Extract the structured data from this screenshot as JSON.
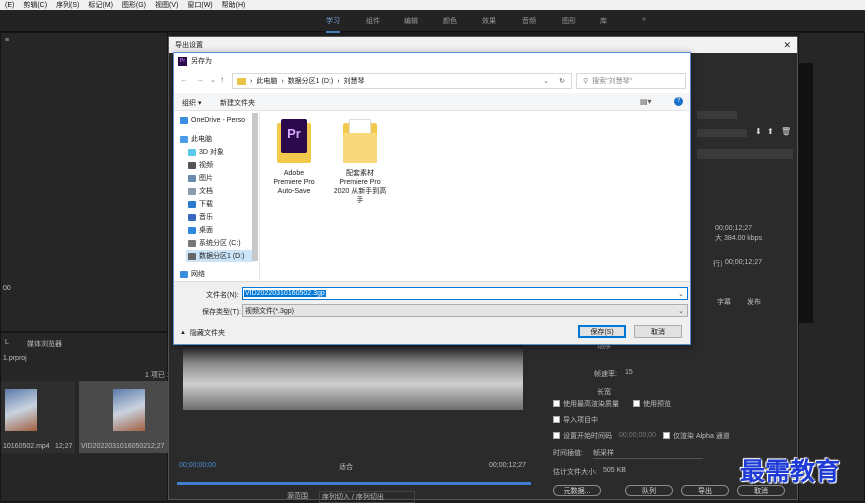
{
  "menubar": {
    "items": [
      "(E)",
      "剪辑(C)",
      "序列(S)",
      "标记(M)",
      "图形(G)",
      "视图(V)",
      "窗口(W)",
      "帮助(H)"
    ]
  },
  "workspace": {
    "tabs": [
      "学习",
      "组件",
      "编辑",
      "颜色",
      "效果",
      "音频",
      "图形",
      "库"
    ],
    "active": "学习",
    "more": "»"
  },
  "left_panel": {
    "tab1": "≡",
    "project_tab": "媒体浏览器",
    "project_file": "1.prproj",
    "items_count": "1 项已 1",
    "clips": [
      {
        "name": "10160502.mp4",
        "duration": "12;27"
      },
      {
        "name": "VID20220310160502",
        "duration": "12;27"
      }
    ]
  },
  "left_misc": {
    "text1": "00",
    "text2": "L"
  },
  "export_dialog": {
    "title": "导出设置",
    "close": "✕",
    "right_info": {
      "time": "00;00;12;27",
      "bitrate": "大 384.00 kbps",
      "time2": "00;00;12;27",
      "line1": "行）",
      "tabs": [
        "字幕",
        "发布"
      ]
    },
    "video_settings": {
      "frame_rate_label": "帧速率:",
      "frame_rate_value": "15",
      "field_label": "场序",
      "aspect_label": "长宽"
    },
    "options": {
      "max_depth": "使用最高渲染质量",
      "use_preview": "使用预览",
      "import_project": "导入项目中",
      "set_timecode": "设置开始时间码",
      "timecode_value": "00;00;00;00",
      "alpha_only": "仅渲染 Alpha 通道",
      "interp_label": "时间插值:",
      "interp_value": "帧采样",
      "filesize_label": "估计文件大小:",
      "filesize_value": "505 KB"
    },
    "buttons": {
      "metadata": "元数据...",
      "queue": "队列",
      "export": "导出",
      "cancel": "取消"
    },
    "timeline": {
      "start": "00;00;00;00",
      "end": "00;00;12;27",
      "fit": "适合",
      "range_label": "源范围",
      "range_value": "序列切入 / 序列切出"
    }
  },
  "saveas": {
    "title": "另存为",
    "breadcrumb": [
      "此电脑",
      "数据分区1 (D:)",
      "刘慧琴"
    ],
    "search_placeholder": "搜索\"刘慧琴\"",
    "toolbar": {
      "organize": "组织 ▾",
      "new_folder": "新建文件夹"
    },
    "nav": [
      {
        "label": "OneDrive - Perso",
        "icon": "cloud-icon"
      },
      {
        "label": "此电脑",
        "icon": "computer-icon"
      },
      {
        "label": "3D 对象",
        "icon": "cube-icon"
      },
      {
        "label": "视频",
        "icon": "video-icon"
      },
      {
        "label": "图片",
        "icon": "picture-icon"
      },
      {
        "label": "文档",
        "icon": "document-icon"
      },
      {
        "label": "下载",
        "icon": "download-icon"
      },
      {
        "label": "音乐",
        "icon": "music-icon"
      },
      {
        "label": "桌面",
        "icon": "desktop-icon"
      },
      {
        "label": "系统分区 (C:)",
        "icon": "drive-icon"
      },
      {
        "label": "数据分区1 (D:)",
        "icon": "drive-icon"
      },
      {
        "label": "网络",
        "icon": "network-icon"
      }
    ],
    "files": [
      {
        "lines": [
          "Adobe",
          "Premiere Pro",
          "Auto-Save"
        ]
      },
      {
        "lines": [
          "配套素材",
          "Premiere Pro",
          "2020 从新手到高",
          "手"
        ]
      }
    ],
    "filename_label": "文件名(N):",
    "filename_value": "VID20220310160502.3gp",
    "filetype_label": "保存类型(T):",
    "filetype_value": "视频文件(*.3gp)",
    "hide_folders": "隐藏文件夹",
    "save": "保存(S)",
    "cancel": "取消"
  },
  "watermark": "最需教育"
}
